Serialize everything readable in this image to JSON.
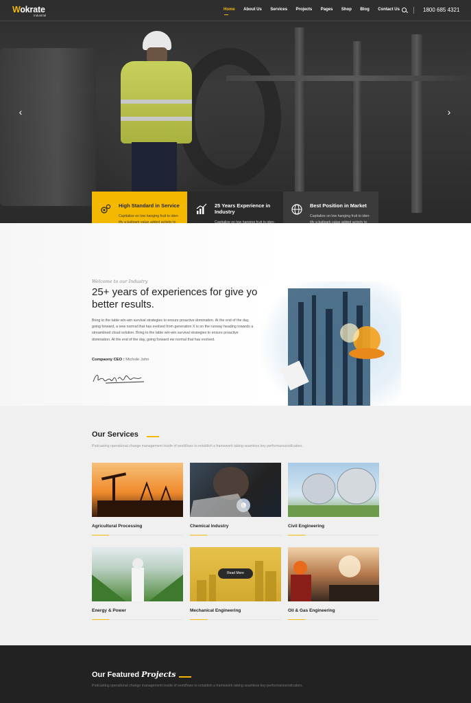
{
  "nav": {
    "logo_mark": "W",
    "logo_text": "okrate",
    "logo_sub": "Industrial",
    "menu": [
      "Home",
      "About Us",
      "Services",
      "Projects",
      "Pages",
      "Shop",
      "Blog",
      "Contact Us"
    ],
    "active": "Home",
    "phone": "1800 685 4321"
  },
  "hero": {
    "prev_arrow": "‹",
    "next_arrow": "›"
  },
  "features": [
    {
      "title": "High Standard in Service",
      "text": "Capitalize on low hanging fruit to iden- tify a ballpark value added activity to beta test. Override the digital divide.",
      "icon": "gears-icon"
    },
    {
      "title": "25 Years Experience in Industry",
      "text": "Capitalize on low hanging fruit to iden- tify a ballpark value added activity to beta test. Override the digital divide.",
      "icon": "chart-icon"
    },
    {
      "title": "Best Position in Market",
      "text": "Capitalize on low hanging fruit to iden- tify a ballpark value added activity to beta test. Override the digital divide.",
      "icon": "globe-icon"
    }
  ],
  "about": {
    "welcome": "Welcome to our Industry",
    "title": "25+ years of experiences for give you better results.",
    "text": "Bring to the table win-win survival strategies to ensure proactive domination. At the end of the day, going forward, a new normal that has evolved from generation X is on the runway heading towards a streamlined cloud solution. Bring to the table win-win survival strategies to ensure proactive domination. At the end of the day, going forward ew normal that has evolved.",
    "ceo_label": "Compaony CEO :",
    "ceo_name": " Michole John"
  },
  "services": {
    "title": "Our Services",
    "subtitle": "Podcasting operational change management inside of workflows to establish a framework taking seamless key performanceindicators.",
    "read_more": "Read More",
    "items": [
      {
        "title": "Agricultural Processing"
      },
      {
        "title": "Chemical Industry"
      },
      {
        "title": "Civil Engineering"
      },
      {
        "title": "Energy & Power"
      },
      {
        "title": "Mechanical Engineering"
      },
      {
        "title": "Oil & Gas Engineering"
      }
    ]
  },
  "projects": {
    "title_plain": "Our Featured ",
    "title_italic": "Projects",
    "subtitle": "Podcasting operational change management inside of workflows to establish a framework taking seamless key performanceindicators."
  },
  "colors": {
    "accent": "#f5b800",
    "dark": "#2a2a2a"
  }
}
